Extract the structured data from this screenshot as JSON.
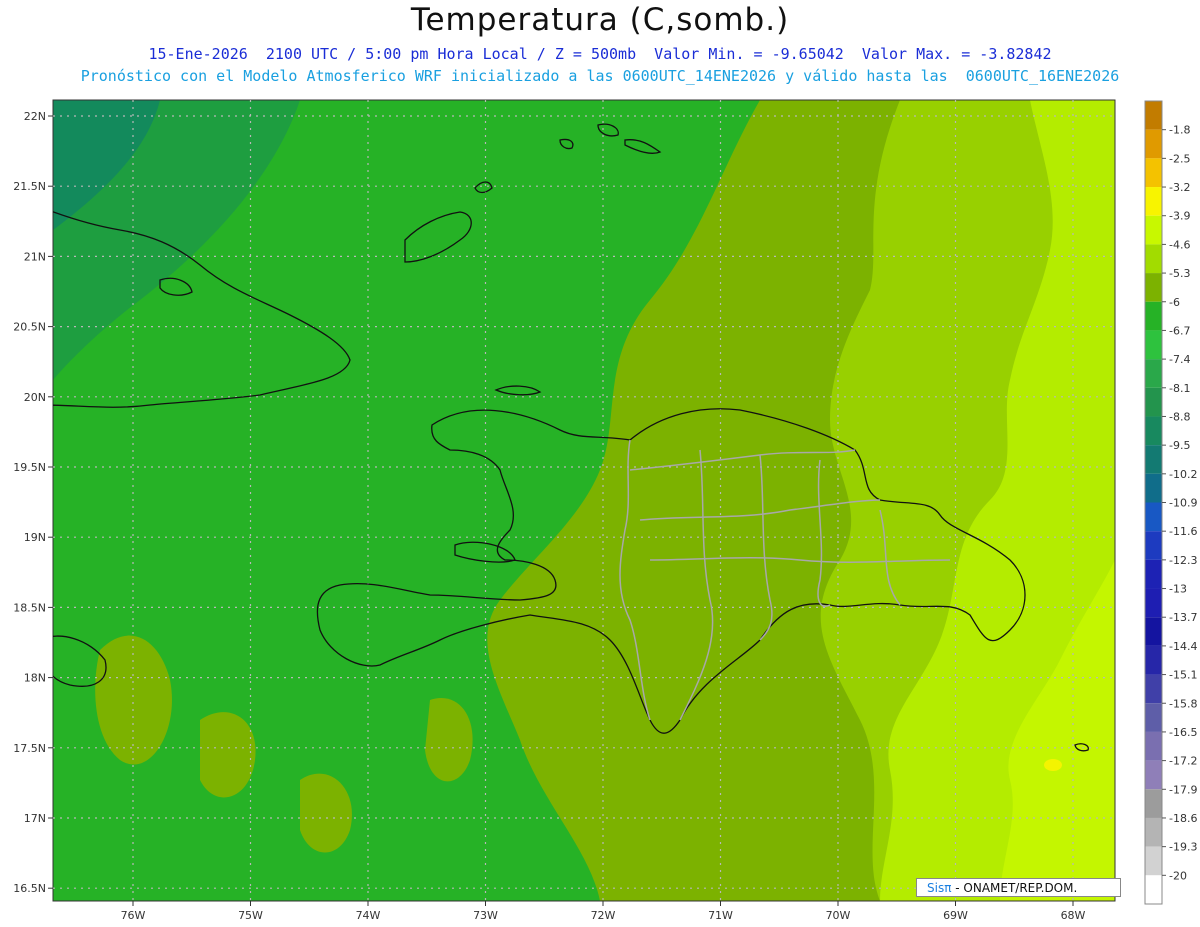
{
  "header": {
    "title": "Temperatura (C,somb.)",
    "line1": "15-Ene-2026  2100 UTC / 5:00 pm Hora Local / Z = 500mb  Valor Min. = -9.65042  Valor Max. = -3.82842",
    "line2": "Pronóstico con el Modelo Atmosferico WRF inicializado a las 0600UTC_14ENE2026 y válido hasta las  0600UTC_16ENE2026"
  },
  "axes": {
    "lat_labels": [
      "22N",
      "21.5N",
      "21N",
      "20.5N",
      "20N",
      "19.5N",
      "19N",
      "18.5N",
      "18N",
      "17.5N",
      "17N",
      "16.5N"
    ],
    "lon_labels": [
      "76W",
      "75W",
      "74W",
      "73W",
      "72W",
      "71W",
      "70W",
      "69W",
      "68W"
    ]
  },
  "colorbar": {
    "labels": [
      "-1.8",
      "-2.5",
      "-3.2",
      "-3.9",
      "-4.6",
      "-5.3",
      "-6",
      "-6.7",
      "-7.4",
      "-8.1",
      "-8.8",
      "-9.5",
      "-10.2",
      "-10.9",
      "-11.6",
      "-12.3",
      "-13",
      "-13.7",
      "-14.4",
      "-15.1",
      "-15.8",
      "-16.5",
      "-17.2",
      "-17.9",
      "-18.6",
      "-19.3",
      "-20"
    ],
    "colors": [
      "#c27c00",
      "#e09a00",
      "#f4c200",
      "#f8f400",
      "#c8f800",
      "#a2dc00",
      "#7cb200",
      "#26b226",
      "#2ec23e",
      "#2aa84a",
      "#23944d",
      "#18895f",
      "#137a72",
      "#106d8a",
      "#1858c4",
      "#1d3bc0",
      "#1d22b4",
      "#1e1eb2",
      "#1414a0",
      "#2626a8",
      "#4040a8",
      "#5e5ea8",
      "#7a6fb0",
      "#8f7fb8",
      "#9c9c9c",
      "#b4b4b4",
      "#d2d2d2",
      "#ffffff"
    ]
  },
  "credit": {
    "brand": "Sisπ",
    "text": " - ONAMET/REP.DOM."
  }
}
